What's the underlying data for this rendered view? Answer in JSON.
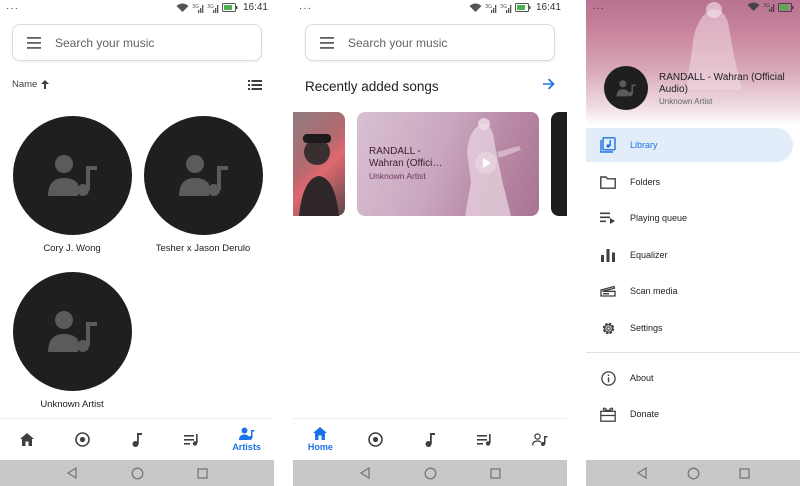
{
  "status": {
    "time": "16:41",
    "dots": "···",
    "network": "3G"
  },
  "search": {
    "placeholder": "Search your music"
  },
  "artists_screen": {
    "sort_label": "Name",
    "artists": [
      {
        "name": "Cory J. Wong"
      },
      {
        "name": "Tesher x Jason Derulo"
      },
      {
        "name": "Unknown Artist"
      }
    ],
    "nav_active_label": "Artists"
  },
  "home_screen": {
    "section_title": "Recently added songs",
    "card": {
      "title": "RANDALL - Wahran (Offici…",
      "artist": "Unknown Artist"
    },
    "nav_active_label": "Home"
  },
  "drawer": {
    "now_playing": {
      "title": "RANDALL - Wahran (Official Audio)",
      "artist": "Unknown Artist"
    },
    "items": [
      {
        "label": "Library",
        "icon": "library-icon"
      },
      {
        "label": "Folders",
        "icon": "folder-icon"
      },
      {
        "label": "Playing queue",
        "icon": "queue-icon"
      },
      {
        "label": "Equalizer",
        "icon": "equalizer-icon"
      },
      {
        "label": "Scan media",
        "icon": "scan-icon"
      },
      {
        "label": "Settings",
        "icon": "gear-icon"
      }
    ],
    "secondary_items": [
      {
        "label": "About",
        "icon": "info-icon"
      },
      {
        "label": "Donate",
        "icon": "gift-icon"
      }
    ]
  },
  "colors": {
    "accent": "#1a73e8",
    "avatar_bg": "#1f1f20",
    "active_bg": "#e3ecf9"
  }
}
